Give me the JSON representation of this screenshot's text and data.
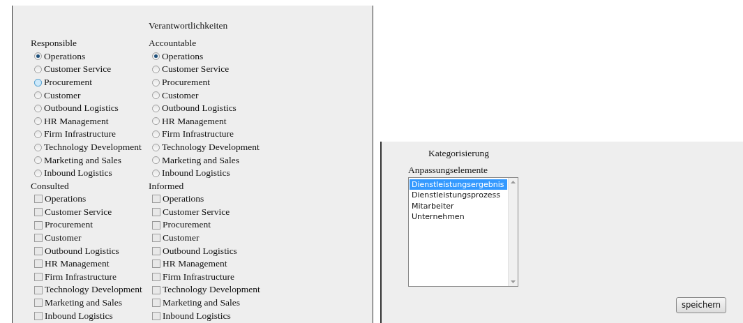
{
  "responsibilities": {
    "title": "Verantwortlichkeiten",
    "groups": [
      {
        "title": "Responsible",
        "kind": "radio",
        "items": [
          {
            "label": "Operations",
            "selected": true,
            "hovered": false
          },
          {
            "label": "Customer Service",
            "selected": false,
            "hovered": false
          },
          {
            "label": "Procurement",
            "selected": false,
            "hovered": true
          },
          {
            "label": "Customer",
            "selected": false,
            "hovered": false
          },
          {
            "label": "Outbound Logistics",
            "selected": false,
            "hovered": false
          },
          {
            "label": "HR Management",
            "selected": false,
            "hovered": false
          },
          {
            "label": "Firm Infrastructure",
            "selected": false,
            "hovered": false
          },
          {
            "label": "Technology Development",
            "selected": false,
            "hovered": false
          },
          {
            "label": "Marketing and Sales",
            "selected": false,
            "hovered": false
          },
          {
            "label": "Inbound Logistics",
            "selected": false,
            "hovered": false
          }
        ]
      },
      {
        "title": "Accountable",
        "kind": "radio",
        "items": [
          {
            "label": "Operations",
            "selected": true,
            "hovered": false
          },
          {
            "label": "Customer Service",
            "selected": false,
            "hovered": false
          },
          {
            "label": "Procurement",
            "selected": false,
            "hovered": false
          },
          {
            "label": "Customer",
            "selected": false,
            "hovered": false
          },
          {
            "label": "Outbound Logistics",
            "selected": false,
            "hovered": false
          },
          {
            "label": "HR Management",
            "selected": false,
            "hovered": false
          },
          {
            "label": "Firm Infrastructure",
            "selected": false,
            "hovered": false
          },
          {
            "label": "Technology Development",
            "selected": false,
            "hovered": false
          },
          {
            "label": "Marketing and Sales",
            "selected": false,
            "hovered": false
          },
          {
            "label": "Inbound Logistics",
            "selected": false,
            "hovered": false
          }
        ]
      },
      {
        "title": "Consulted",
        "kind": "checkbox",
        "items": [
          {
            "label": "Operations",
            "checked": false
          },
          {
            "label": "Customer Service",
            "checked": false
          },
          {
            "label": "Procurement",
            "checked": false
          },
          {
            "label": "Customer",
            "checked": false
          },
          {
            "label": "Outbound Logistics",
            "checked": false
          },
          {
            "label": "HR Management",
            "checked": false
          },
          {
            "label": "Firm Infrastructure",
            "checked": false
          },
          {
            "label": "Technology Development",
            "checked": false
          },
          {
            "label": "Marketing and Sales",
            "checked": false
          },
          {
            "label": "Inbound Logistics",
            "checked": false
          }
        ]
      },
      {
        "title": "Informed",
        "kind": "checkbox",
        "items": [
          {
            "label": "Operations",
            "checked": false
          },
          {
            "label": "Customer Service",
            "checked": false
          },
          {
            "label": "Procurement",
            "checked": false
          },
          {
            "label": "Customer",
            "checked": false
          },
          {
            "label": "Outbound Logistics",
            "checked": false
          },
          {
            "label": "HR Management",
            "checked": false
          },
          {
            "label": "Firm Infrastructure",
            "checked": false
          },
          {
            "label": "Technology Development",
            "checked": false
          },
          {
            "label": "Marketing and Sales",
            "checked": false
          },
          {
            "label": "Inbound Logistics",
            "checked": false
          }
        ]
      }
    ]
  },
  "categorization": {
    "title": "Kategorisierung",
    "list_label": "Anpassungselemente",
    "list_items": [
      {
        "label": "Dienstleistungsergebnis",
        "selected": true
      },
      {
        "label": "Dienstleistungsprozess",
        "selected": false
      },
      {
        "label": "Mitarbeiter",
        "selected": false
      },
      {
        "label": "Unternehmen",
        "selected": false
      }
    ],
    "save_button": "speichern"
  }
}
